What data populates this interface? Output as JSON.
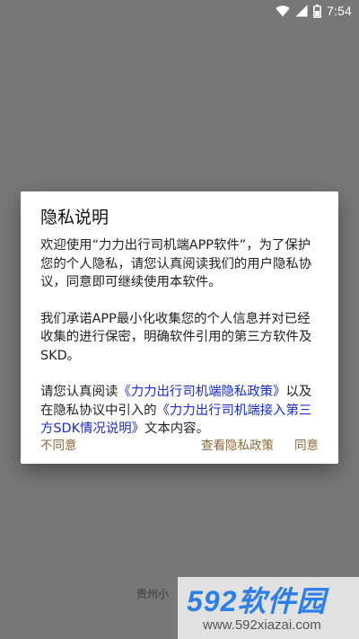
{
  "status_bar": {
    "time": "7:54"
  },
  "dialog": {
    "title": "隐私说明",
    "paragraph1": "欢迎使用“力力出行司机端APP软件”，为了保护您的个人隐私，请您认真阅读我们的用户隐私协议，同意即可继续使用本软件。",
    "paragraph2": "我们承诺APP最小化收集您的个人信息并对已经收集的进行保密，明确软件引用的第三方软件及SKD。",
    "paragraph3": {
      "prefix": "请您认真阅读",
      "link1": "《力力出行司机端隐私政策》",
      "middle": "以及在隐私协议中引入的",
      "link2": "《力力出行司机端接入第三方SDK情况说明》",
      "suffix": "文本内容。"
    },
    "buttons": {
      "decline": "不同意",
      "view_policy": "查看隐私政策",
      "agree": "同意"
    },
    "colors": {
      "link": "#1a2dcc",
      "button_text": "#8b6a38"
    }
  },
  "background": {
    "footer_text": "贵州小"
  },
  "watermark": {
    "logo": "592软件园",
    "url": "www.592xiazai.com"
  }
}
